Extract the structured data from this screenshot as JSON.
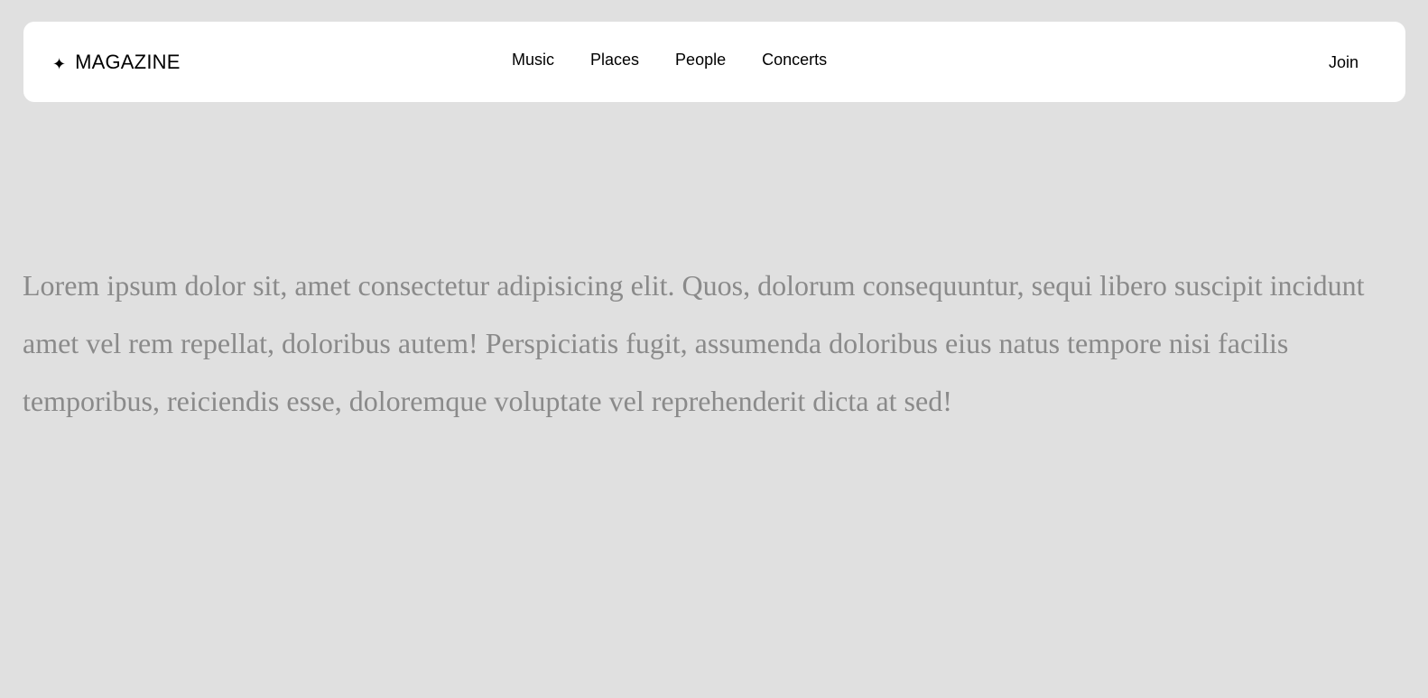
{
  "header": {
    "brand": {
      "icon": "sparkle-icon",
      "icon_glyph": "✦",
      "name": "MAGAZINE"
    },
    "nav": [
      {
        "label": "Music"
      },
      {
        "label": "Places"
      },
      {
        "label": "People"
      },
      {
        "label": "Concerts"
      }
    ],
    "join_label": "Join"
  },
  "main": {
    "paragraph": "Lorem ipsum dolor sit, amet consectetur adipisicing elit. Quos, dolorum consequuntur, sequi libero suscipit incidunt amet vel rem repellat, doloribus autem! Perspiciatis fugit, assumenda doloribus eius natus tempore nisi facilis temporibus, reiciendis esse, doloremque voluptate vel reprehenderit dicta at sed!"
  },
  "colors": {
    "page_background": "#e0e0e0",
    "header_background": "#ffffff",
    "text_primary": "#000000",
    "text_muted": "#8a8a8a"
  }
}
